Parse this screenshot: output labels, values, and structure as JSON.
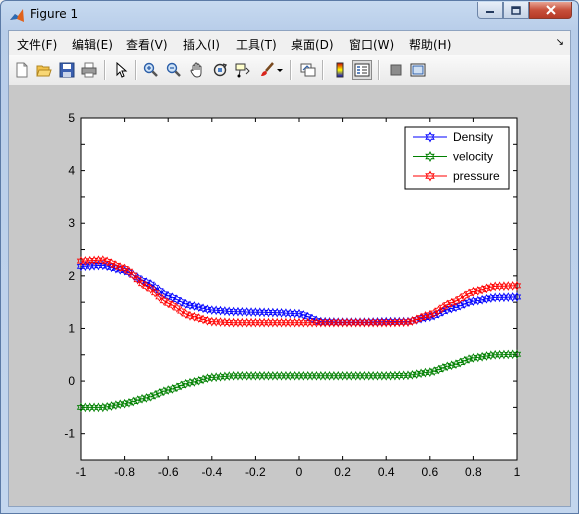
{
  "window": {
    "title": "Figure 1"
  },
  "menu": [
    "文件(F)",
    "编辑(E)",
    "查看(V)",
    "插入(I)",
    "工具(T)",
    "桌面(D)",
    "窗口(W)",
    "帮助(H)"
  ],
  "toolbar": [
    "new-figure",
    "open-file",
    "save-figure",
    "print-figure",
    "edit-plot",
    "zoom-in",
    "zoom-out",
    "pan",
    "rotate-3d",
    "data-cursor",
    "brush",
    "link-plot",
    "insert-colorbar",
    "insert-legend",
    "hide-plot-tools",
    "show-plot-tools"
  ],
  "chart_data": {
    "type": "line",
    "xlim": [
      -1,
      1
    ],
    "ylim": [
      -1.5,
      5
    ],
    "x_ticks": [
      "-1",
      "-0.8",
      "-0.6",
      "-0.4",
      "-0.2",
      "0",
      "0.2",
      "0.4",
      "0.6",
      "0.8",
      "1"
    ],
    "y_ticks": [
      "-1",
      "0",
      "1",
      "2",
      "3",
      "4",
      "5"
    ],
    "grid": false,
    "legend_position": "top-right",
    "marker": "hexagram",
    "x": [
      -1.0,
      -0.9,
      -0.8,
      -0.7,
      -0.6,
      -0.5,
      -0.4,
      -0.3,
      -0.2,
      -0.1,
      0.0,
      0.1,
      0.2,
      0.3,
      0.4,
      0.5,
      0.6,
      0.7,
      0.8,
      0.9,
      1.0
    ],
    "series": [
      {
        "name": "Density",
        "color": "#0000ff",
        "values": [
          2.18,
          2.2,
          2.1,
          1.88,
          1.62,
          1.44,
          1.35,
          1.32,
          1.31,
          1.3,
          1.28,
          1.13,
          1.12,
          1.12,
          1.13,
          1.13,
          1.22,
          1.38,
          1.52,
          1.59,
          1.6
        ]
      },
      {
        "name": "velocity",
        "color": "#008000",
        "values": [
          -0.5,
          -0.5,
          -0.43,
          -0.32,
          -0.17,
          -0.03,
          0.07,
          0.1,
          0.1,
          0.1,
          0.1,
          0.1,
          0.1,
          0.1,
          0.1,
          0.11,
          0.17,
          0.3,
          0.44,
          0.5,
          0.51
        ]
      },
      {
        "name": "pressure",
        "color": "#ff0000",
        "values": [
          2.28,
          2.3,
          2.14,
          1.8,
          1.48,
          1.24,
          1.13,
          1.11,
          1.11,
          1.11,
          1.11,
          1.11,
          1.11,
          1.11,
          1.11,
          1.12,
          1.26,
          1.49,
          1.7,
          1.8,
          1.81
        ]
      }
    ]
  }
}
